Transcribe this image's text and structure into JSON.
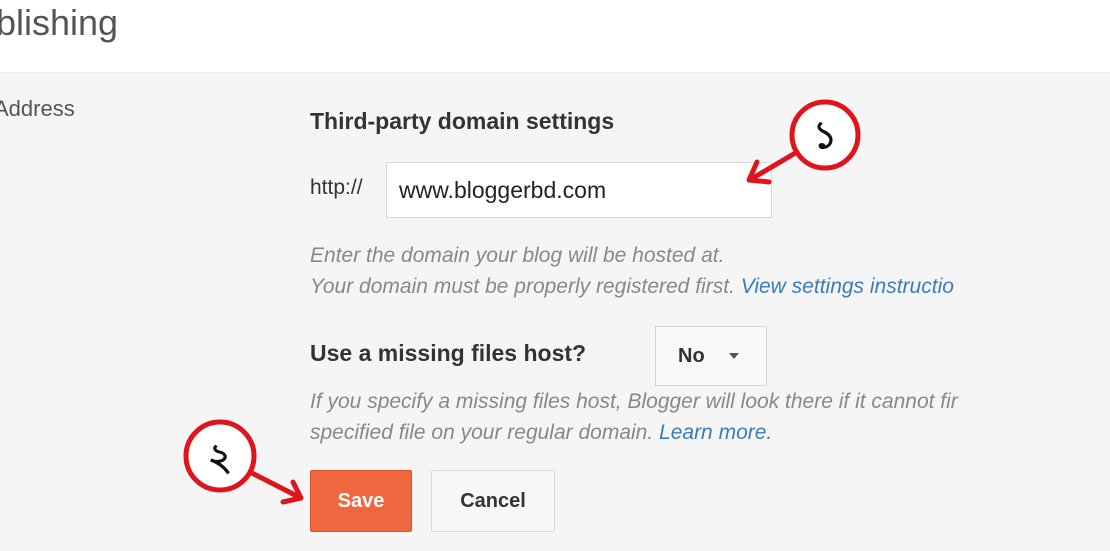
{
  "header": {
    "title": "blishing"
  },
  "sidebar": {
    "label": "Address"
  },
  "domain_settings": {
    "title": "Third-party domain settings",
    "protocol_label": "http://",
    "domain_value": "www.bloggerbd.com",
    "help_line1": "Enter the domain your blog will be hosted at.",
    "help_line2_prefix": "Your domain must be properly registered first. ",
    "help_link": "View settings instructio"
  },
  "missing_files": {
    "label": "Use a missing files host?",
    "selected": "No",
    "help_line1": "If you specify a missing files host, Blogger will look there if it cannot fir",
    "help_line2_prefix": "specified file on your regular domain. ",
    "help_link": "Learn more."
  },
  "buttons": {
    "save": "Save",
    "cancel": "Cancel"
  },
  "annotations": {
    "marker_1": "১",
    "marker_2": "২"
  },
  "colors": {
    "save_button": "#f0673f",
    "link": "#3b7bbf",
    "annotation": "#e0141b"
  }
}
